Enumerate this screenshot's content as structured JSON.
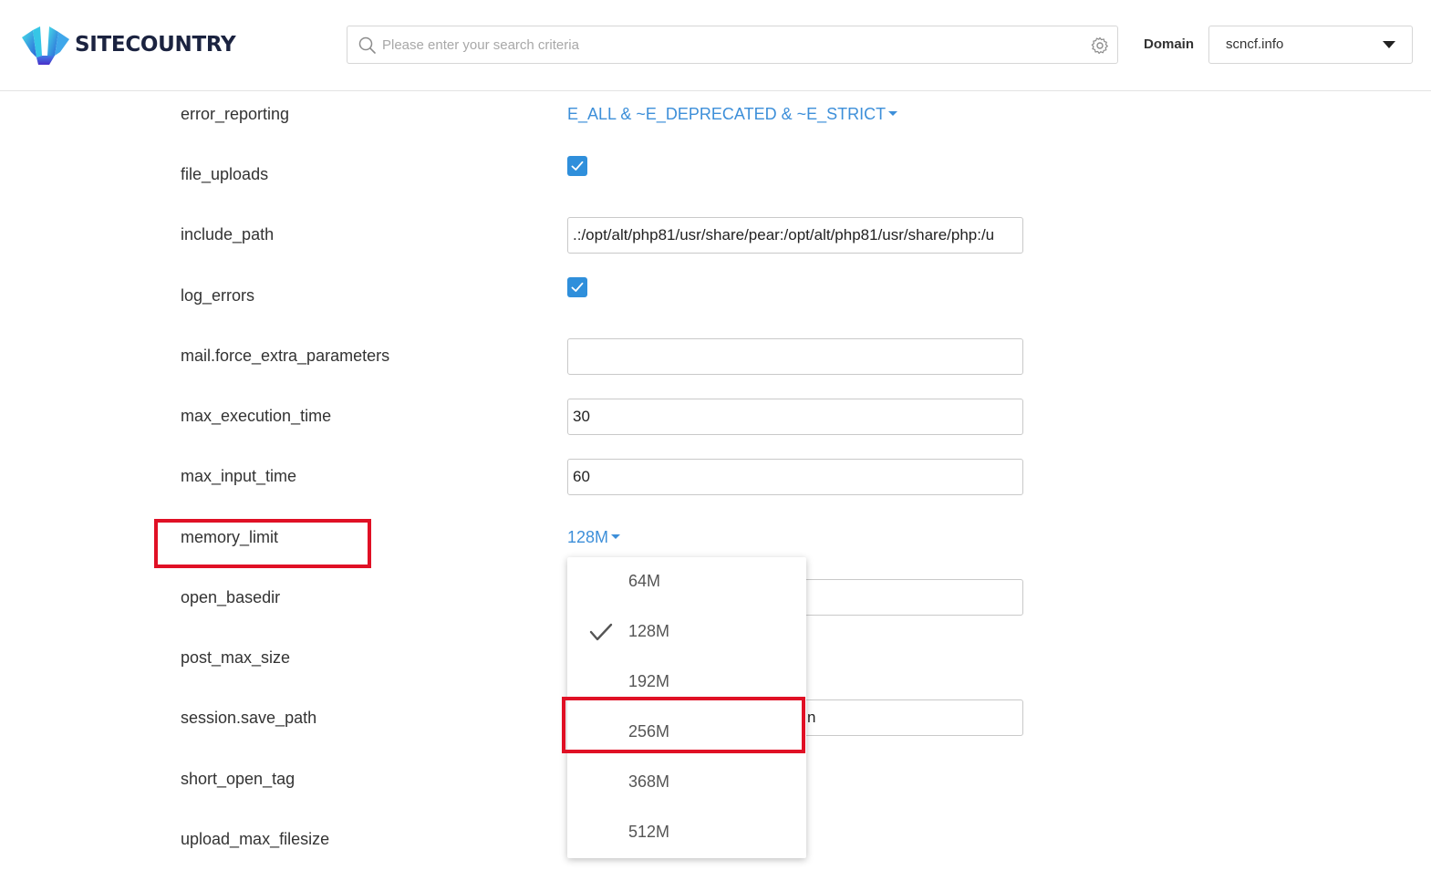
{
  "header": {
    "logo_text": "SITECOUNTRY",
    "search_placeholder": "Please enter your search criteria",
    "domain_label": "Domain",
    "domain_value": "scncf.info"
  },
  "settings": {
    "error_reporting": {
      "label": "error_reporting",
      "value": "E_ALL & ~E_DEPRECATED & ~E_STRICT"
    },
    "file_uploads": {
      "label": "file_uploads",
      "checked": true
    },
    "include_path": {
      "label": "include_path",
      "value": ".:/opt/alt/php81/usr/share/pear:/opt/alt/php81/usr/share/php:/u"
    },
    "log_errors": {
      "label": "log_errors",
      "checked": true
    },
    "mail_force_extra_parameters": {
      "label": "mail.force_extra_parameters",
      "value": ""
    },
    "max_execution_time": {
      "label": "max_execution_time",
      "value": "30"
    },
    "max_input_time": {
      "label": "max_input_time",
      "value": "60"
    },
    "memory_limit": {
      "label": "memory_limit",
      "value": "128M"
    },
    "open_basedir": {
      "label": "open_basedir"
    },
    "post_max_size": {
      "label": "post_max_size"
    },
    "session_save_path": {
      "label": "session.save_path",
      "visible_fragment": "n"
    },
    "short_open_tag": {
      "label": "short_open_tag"
    },
    "upload_max_filesize": {
      "label": "upload_max_filesize"
    }
  },
  "memory_dropdown": {
    "options": [
      "64M",
      "128M",
      "192M",
      "256M",
      "368M",
      "512M"
    ],
    "selected": "128M"
  },
  "icons": {
    "search": "search-icon",
    "settings": "gear-icon",
    "domain_caret": "caret-down-icon",
    "check": "check-icon"
  },
  "colors": {
    "accent": "#3d8fd9",
    "checkbox": "#2f8fdb",
    "highlight": "#e01025",
    "brand_text": "#1b2340"
  }
}
